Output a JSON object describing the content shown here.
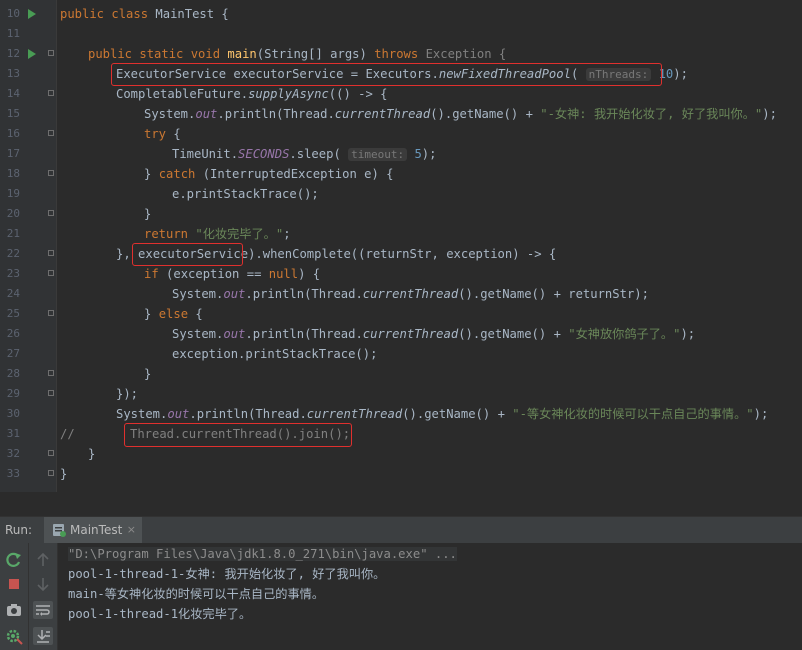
{
  "editor": {
    "lines": [
      {
        "n": "10"
      },
      {
        "n": "11"
      },
      {
        "n": "12"
      },
      {
        "n": "13"
      },
      {
        "n": "14"
      },
      {
        "n": "15"
      },
      {
        "n": "16"
      },
      {
        "n": "17"
      },
      {
        "n": "18"
      },
      {
        "n": "19"
      },
      {
        "n": "20"
      },
      {
        "n": "21"
      },
      {
        "n": "22"
      },
      {
        "n": "23"
      },
      {
        "n": "24"
      },
      {
        "n": "25"
      },
      {
        "n": "26"
      },
      {
        "n": "27"
      },
      {
        "n": "28"
      },
      {
        "n": "29"
      },
      {
        "n": "30"
      },
      {
        "n": "31"
      },
      {
        "n": "32"
      },
      {
        "n": "33"
      }
    ],
    "code": {
      "l10_a": "public class ",
      "l10_b": "MainTest {",
      "l12_a": "public static void ",
      "l12_b": "main",
      "l12_c": "(String[] args) ",
      "l12_d": "throws ",
      "l12_e": "Exception {",
      "l13_a": "ExecutorService executorService = Executors.",
      "l13_b": "newFixedThreadPool",
      "l13_c": "( ",
      "l13_hint": "nThreads:",
      "l13_d": " 10",
      "l13_e": ");",
      "l14_a": "CompletableFuture.",
      "l14_b": "supplyAsync",
      "l14_c": "(() -> {",
      "l15_a": "System.",
      "l15_b": "out",
      "l15_c": ".println(Thread.",
      "l15_d": "currentThread",
      "l15_e": "().getName() + ",
      "l15_f": "\"-女神: 我开始化妆了, 好了我叫你。\"",
      "l15_g": ");",
      "l16_a": "try",
      "l16_b": " {",
      "l17_a": "TimeUnit.",
      "l17_b": "SECONDS",
      "l17_c": ".sleep( ",
      "l17_hint": "timeout:",
      "l17_d": " 5",
      "l17_e": ");",
      "l18_a": "} ",
      "l18_b": "catch",
      "l18_c": " (InterruptedException e) {",
      "l19_a": "e.printStackTrace();",
      "l20_a": "}",
      "l21_a": "return ",
      "l21_b": "\"化妆完毕了。\"",
      "l21_c": ";",
      "l22_a": "}, ",
      "l22_b": "executorService",
      "l22_c": ").whenComplete((returnStr, exception) -> {",
      "l23_a": "if",
      "l23_b": " (exception == ",
      "l23_c": "null",
      "l23_d": ") {",
      "l24_a": "System.",
      "l24_b": "out",
      "l24_c": ".println(Thread.",
      "l24_d": "currentThread",
      "l24_e": "().getName() + returnStr);",
      "l25_a": "} ",
      "l25_b": "else",
      "l25_c": " {",
      "l26_a": "System.",
      "l26_b": "out",
      "l26_c": ".println(Thread.",
      "l26_d": "currentThread",
      "l26_e": "().getName() + ",
      "l26_f": "\"女神放你鸽子了。\"",
      "l26_g": ");",
      "l27_a": "exception.printStackTrace();",
      "l28_a": "}",
      "l29_a": "});",
      "l30_a": "System.",
      "l30_b": "out",
      "l30_c": ".println(Thread.",
      "l30_d": "currentThread",
      "l30_e": "().getName() + ",
      "l30_f": "\"-等女神化妆的时候可以干点自己的事情。\"",
      "l30_g": ");",
      "l31_a": "//",
      "l31_b": "Thread.currentThread().join();",
      "l32_a": "}",
      "l33_a": "}"
    }
  },
  "run_panel": {
    "label": "Run:",
    "tab_label": "MainTest",
    "tab_close": "×"
  },
  "console": {
    "lines": [
      "\"D:\\Program Files\\Java\\jdk1.8.0_271\\bin\\java.exe\" ...",
      "pool-1-thread-1-女神: 我开始化妆了, 好了我叫你。",
      "main-等女神化妆的时候可以干点自己的事情。",
      "pool-1-thread-1化妆完毕了。"
    ]
  },
  "colors": {
    "background": "#2b2b2b",
    "keyword": "#cc7832",
    "string": "#6a8759",
    "number": "#6897bb",
    "highlight_box": "#e0302e",
    "run_icon": "#499c54"
  }
}
